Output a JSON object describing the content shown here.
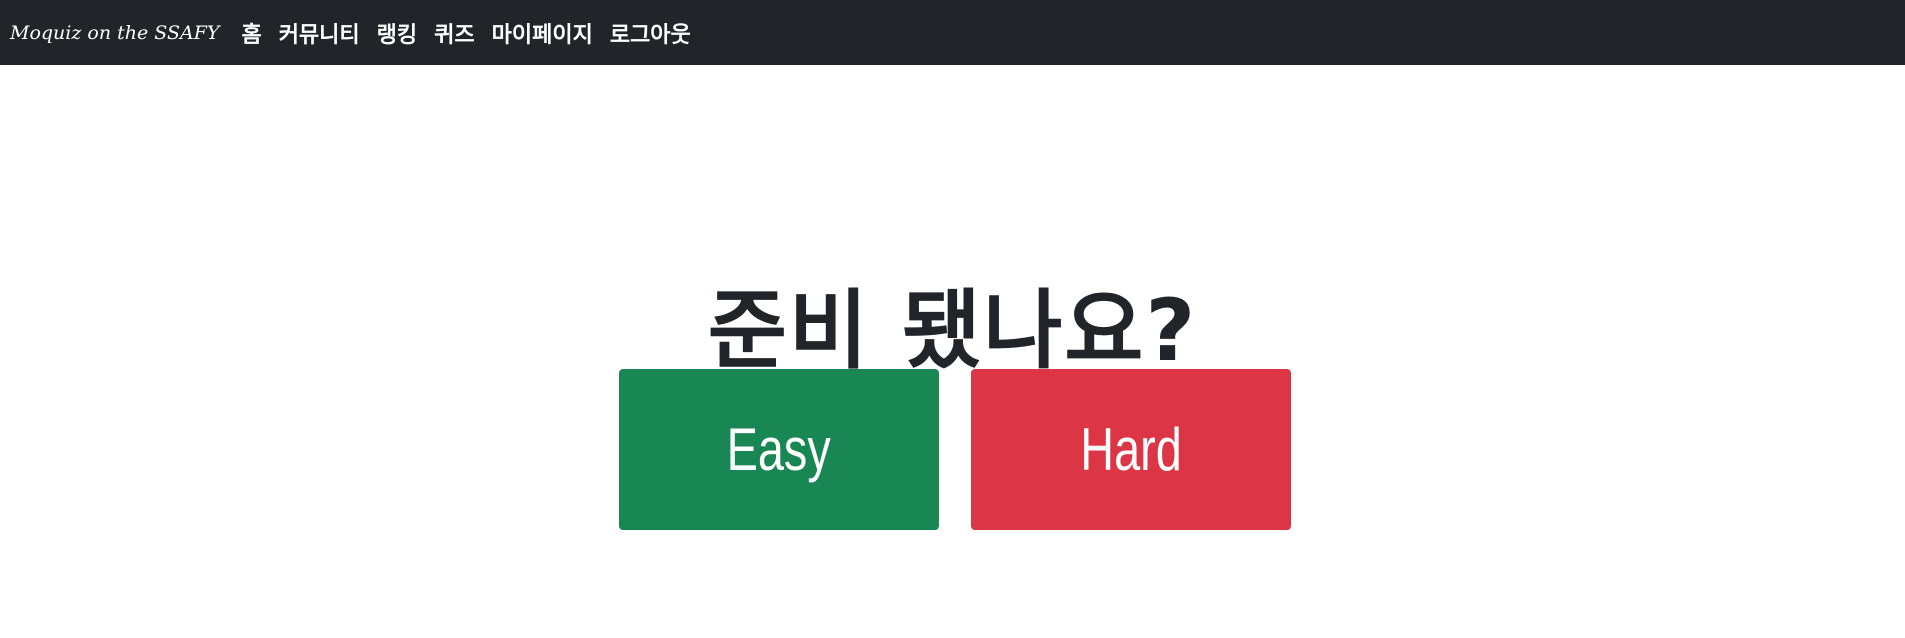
{
  "navbar": {
    "brand": "Moquiz on the SSAFY",
    "links": [
      "홈",
      "커뮤니티",
      "랭킹",
      "퀴즈",
      "마이페이지",
      "로그아웃"
    ],
    "background": "#212529"
  },
  "main": {
    "headline": "준비 됐나요?",
    "buttons": {
      "easy": "Easy",
      "hard": "Hard"
    },
    "colors": {
      "easy": "#198754",
      "hard": "#dc3545"
    }
  }
}
